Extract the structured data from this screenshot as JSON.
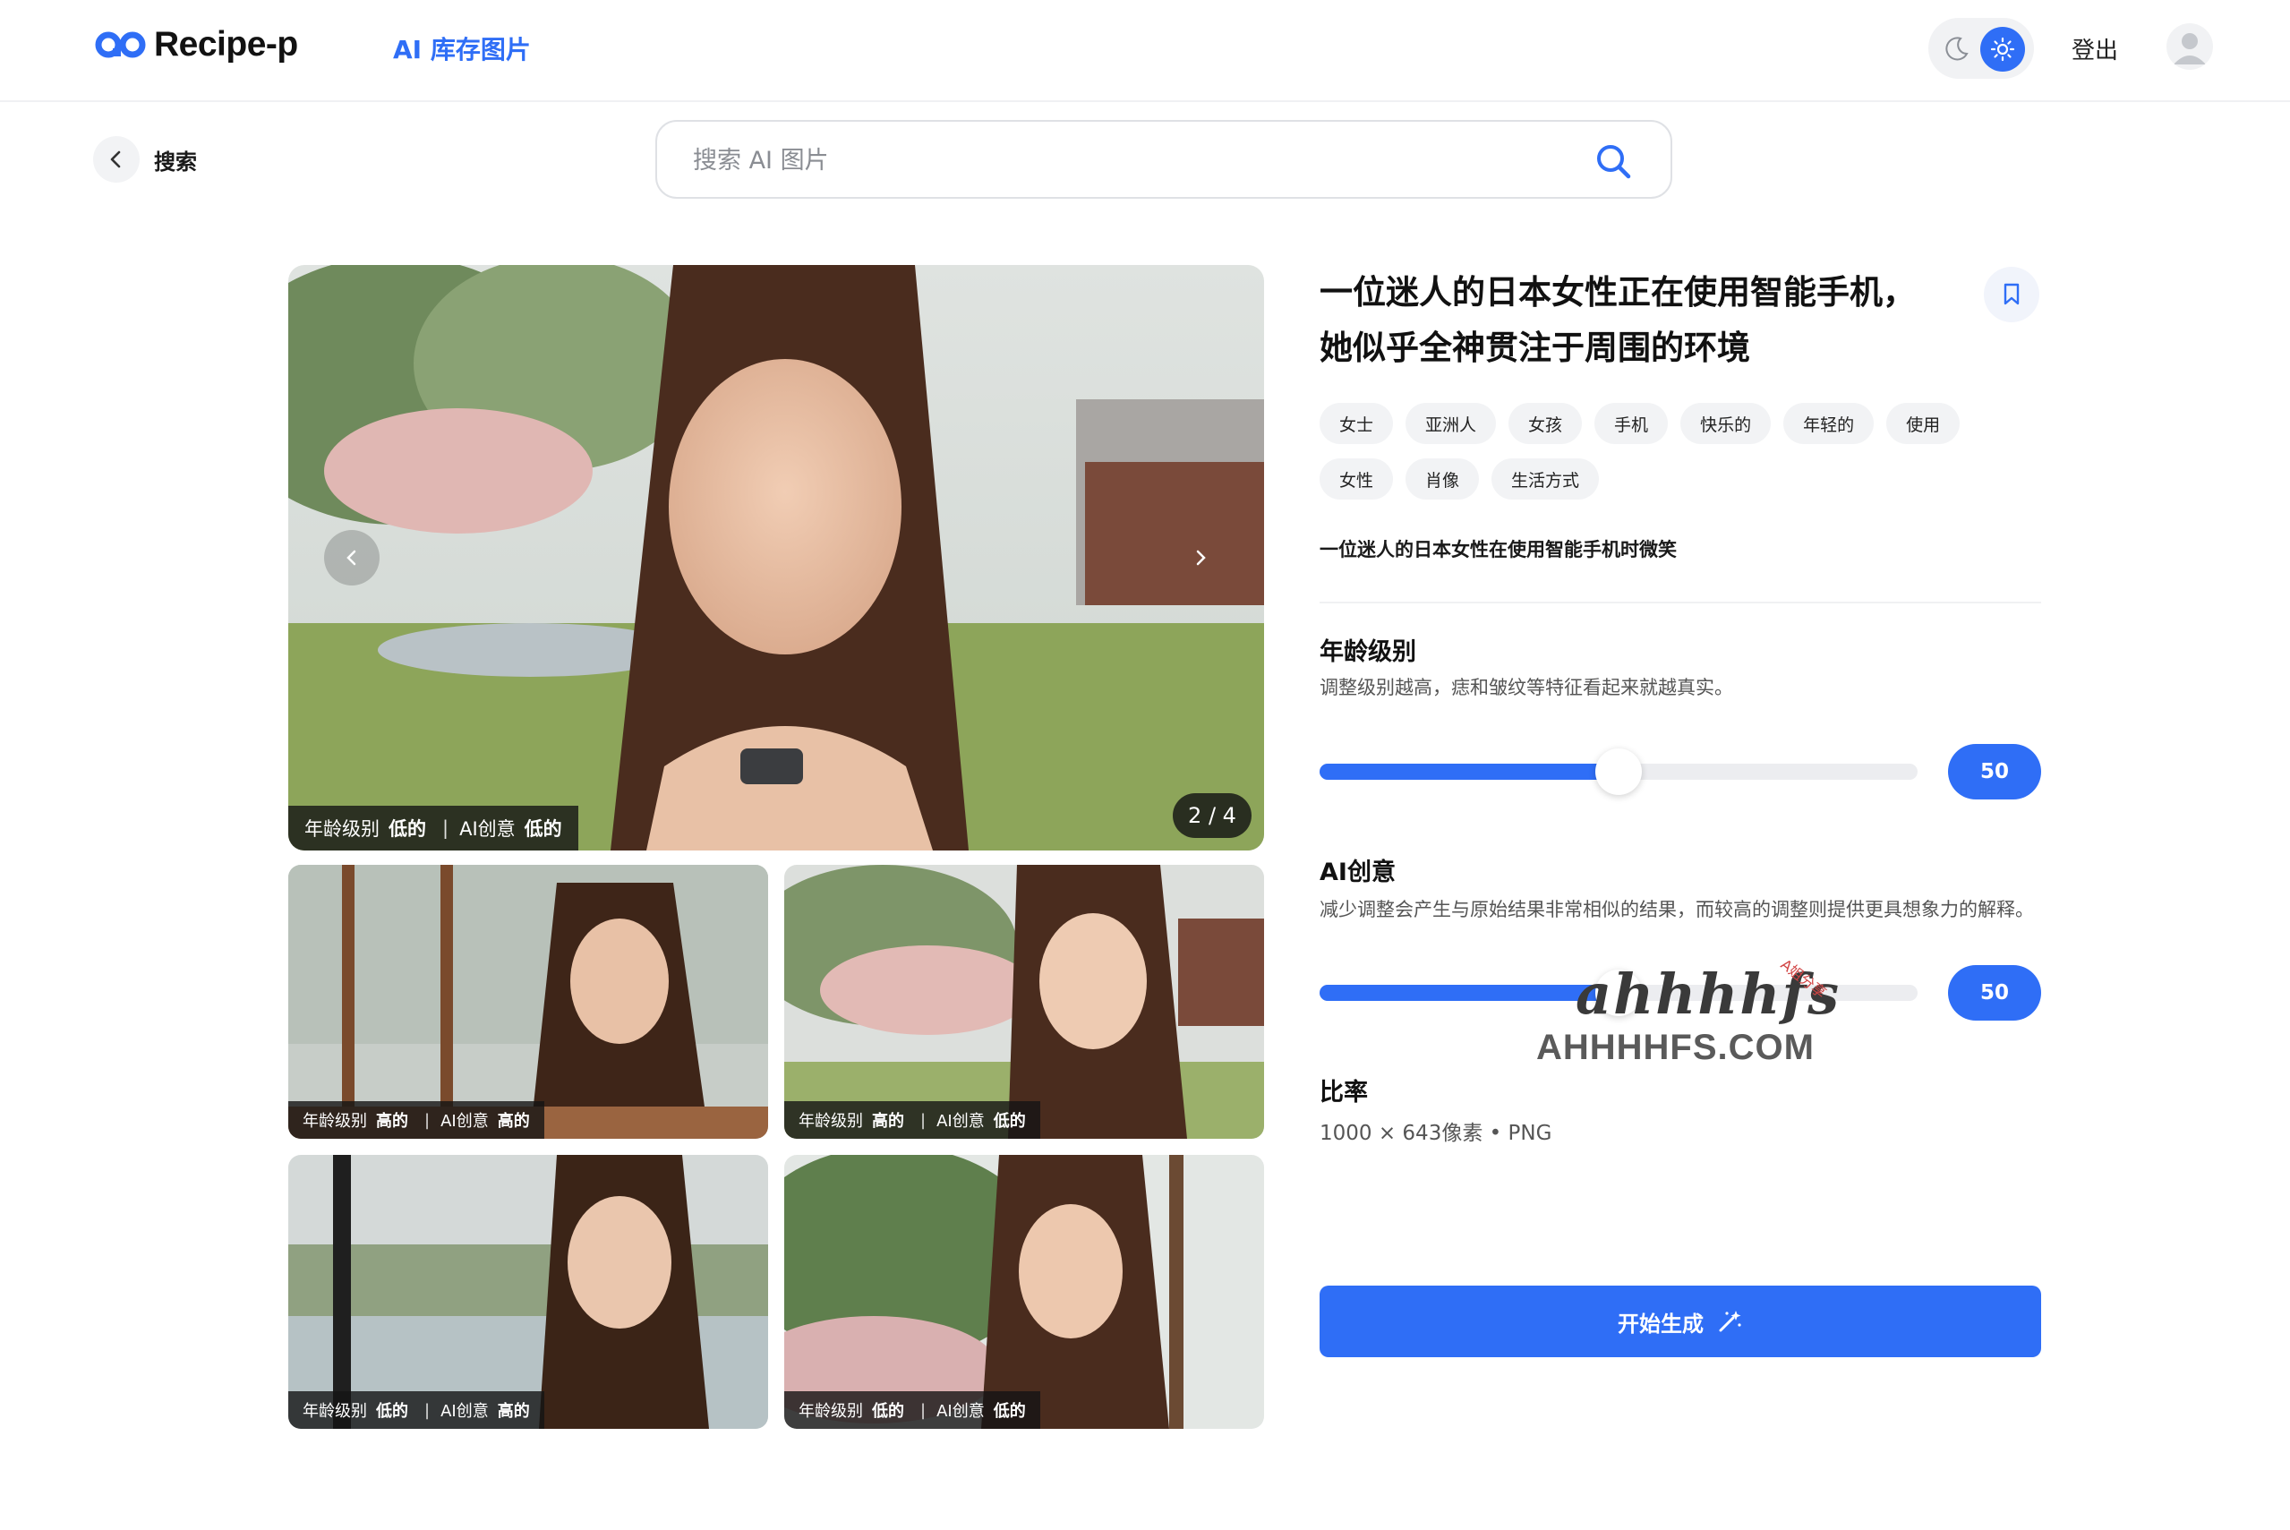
{
  "header": {
    "logo_text": "Recipe-p",
    "nav_link": "AI 库存图片",
    "logout": "登出"
  },
  "subbar": {
    "back_label": "搜索",
    "search_placeholder": "搜索 AI 图片"
  },
  "gallery": {
    "counter": "2 / 4",
    "main_caption": {
      "age_label": "年龄级别",
      "age_value": "低的",
      "ai_label": "AI创意",
      "ai_value": "低的"
    },
    "thumbs": [
      {
        "age_label": "年龄级别",
        "age_value": "高的",
        "ai_label": "AI创意",
        "ai_value": "高的"
      },
      {
        "age_label": "年龄级别",
        "age_value": "高的",
        "ai_label": "AI创意",
        "ai_value": "低的"
      },
      {
        "age_label": "年龄级别",
        "age_value": "低的",
        "ai_label": "AI创意",
        "ai_value": "高的"
      },
      {
        "age_label": "年龄级别",
        "age_value": "低的",
        "ai_label": "AI创意",
        "ai_value": "低的"
      }
    ]
  },
  "detail": {
    "title_line1": "一位迷人的日本女性正在使用智能手机，",
    "title_line2": "她似乎全神贯注于周围的环境",
    "tags": [
      "女士",
      "亚洲人",
      "女孩",
      "手机",
      "快乐的",
      "年轻的",
      "使用",
      "女性",
      "肖像",
      "生活方式"
    ],
    "description": "一位迷人的日本女性在使用智能手机时微笑",
    "age_section": {
      "title": "年龄级别",
      "desc": "调整级别越高，痣和皱纹等特征看起来就越真实。",
      "value": "50",
      "fraction": 0.5
    },
    "ai_section": {
      "title": "AI创意",
      "desc": "减少调整会产生与原始结果非常相似的结果，而较高的调整则提供更具想象力的解释。",
      "value": "50",
      "fraction": 0.5
    },
    "ratio": {
      "title": "比率",
      "value": "1000 × 643像素 • PNG"
    },
    "generate_label": "开始生成"
  },
  "watermark": {
    "script": "ahhhhfs",
    "small": "A姐分享",
    "url": "AHHHHFS.COM"
  },
  "colors": {
    "accent": "#2f6ef6",
    "tag_bg": "#f2f3f5",
    "caption_bg": "#141414"
  }
}
